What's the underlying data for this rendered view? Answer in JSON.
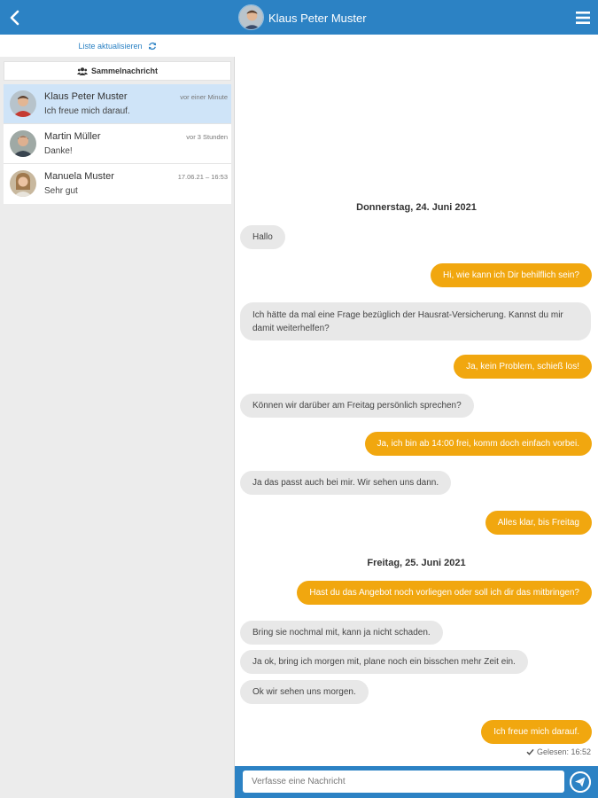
{
  "header": {
    "title": "Klaus Peter Muster",
    "back_icon": "chevron-left-icon",
    "menu_icon": "hamburger-menu-icon"
  },
  "sidebar": {
    "refresh_label": "Liste aktualisieren",
    "group_label": "Sammelnachricht",
    "conversations": [
      {
        "name": "Klaus Peter Muster",
        "time": "vor einer Minute",
        "preview": "Ich freue mich darauf.",
        "active": true
      },
      {
        "name": "Martin Müller",
        "time": "vor 3 Stunden",
        "preview": "Danke!",
        "active": false
      },
      {
        "name": "Manuela Muster",
        "time": "17.06.21 – 16:53",
        "preview": "Sehr gut",
        "active": false
      }
    ]
  },
  "chat": {
    "date_1": "Donnerstag, 24. Juni 2021",
    "date_2": "Freitag, 25. Juni 2021",
    "messages": [
      {
        "dir": "in",
        "text": "Hallo"
      },
      {
        "dir": "out",
        "text": "Hi, wie kann ich Dir behilflich sein?"
      },
      {
        "dir": "in",
        "text": "Ich hätte da mal eine Frage bezüglich der Hausrat-Versicherung. Kannst du mir damit weiterhelfen?"
      },
      {
        "dir": "out",
        "text": "Ja, kein Problem, schieß los!"
      },
      {
        "dir": "in",
        "text": "Können wir darüber am Freitag persönlich sprechen?"
      },
      {
        "dir": "out",
        "text": "Ja, ich bin ab 14:00 frei, komm doch einfach vorbei."
      },
      {
        "dir": "in",
        "text": "Ja das passt auch bei mir. Wir sehen uns dann."
      },
      {
        "dir": "out",
        "text": "Alles klar, bis Freitag"
      },
      {
        "dir": "out",
        "text": "Hast du das Angebot noch vorliegen oder soll ich dir das mitbringen?"
      },
      {
        "dir": "in",
        "text": "Bring sie nochmal mit, kann ja nicht schaden."
      },
      {
        "dir": "in",
        "text": "Ja ok, bring ich morgen mit, plane noch ein bisschen mehr Zeit ein."
      },
      {
        "dir": "in",
        "text": "Ok wir sehen uns morgen."
      },
      {
        "dir": "out",
        "text": "Ich freue mich darauf."
      }
    ],
    "read_status": "Gelesen: 16:52"
  },
  "composer": {
    "placeholder": "Verfasse eine Nachricht",
    "send_icon": "paper-plane-icon"
  },
  "colors": {
    "primary": "#2c82c4",
    "outgoing_bubble": "#f1a70f",
    "incoming_bubble": "#e8e8e8",
    "active_conversation": "#cfe4f8"
  }
}
